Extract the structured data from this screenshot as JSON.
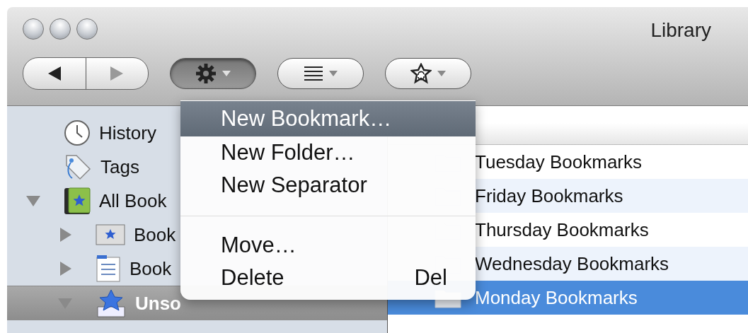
{
  "window": {
    "title": "Library"
  },
  "toolbar": [
    {
      "kind": "back"
    },
    {
      "kind": "forward"
    },
    {
      "kind": "organize",
      "pressed": true
    },
    {
      "kind": "views",
      "pressed": false
    },
    {
      "kind": "import",
      "pressed": false
    }
  ],
  "sidebar": {
    "items": [
      {
        "kind": "history",
        "label": "History",
        "selected": false
      },
      {
        "kind": "tags",
        "label": "Tags",
        "selected": false
      },
      {
        "kind": "all",
        "label": "All Book",
        "selected": false,
        "expanded": true,
        "children": [
          {
            "kind": "toolbar",
            "label": "Book",
            "selected": false,
            "expanded": false
          },
          {
            "kind": "menu",
            "label": "Book",
            "selected": false,
            "expanded": false
          },
          {
            "kind": "unsorted",
            "label": "Unso",
            "selected": true,
            "expanded": true
          }
        ]
      }
    ]
  },
  "list": {
    "rows": [
      {
        "label": "Tuesday Bookmarks",
        "selected": false
      },
      {
        "label": "Friday Bookmarks",
        "selected": false
      },
      {
        "label": "Thursday Bookmarks",
        "selected": false
      },
      {
        "label": "Wednesday Bookmarks",
        "selected": false
      },
      {
        "label": "Monday Bookmarks",
        "selected": true
      }
    ]
  },
  "menu": {
    "items": [
      {
        "kind": "item",
        "label": "New Bookmark…",
        "selected": true
      },
      {
        "kind": "item",
        "label": "New Folder…",
        "selected": false
      },
      {
        "kind": "item",
        "label": "New Separator",
        "selected": false
      },
      {
        "kind": "separator"
      },
      {
        "kind": "item",
        "label": "Move…",
        "selected": false
      },
      {
        "kind": "item",
        "label": "Delete",
        "shortcut": "Del",
        "selected": false
      }
    ]
  }
}
